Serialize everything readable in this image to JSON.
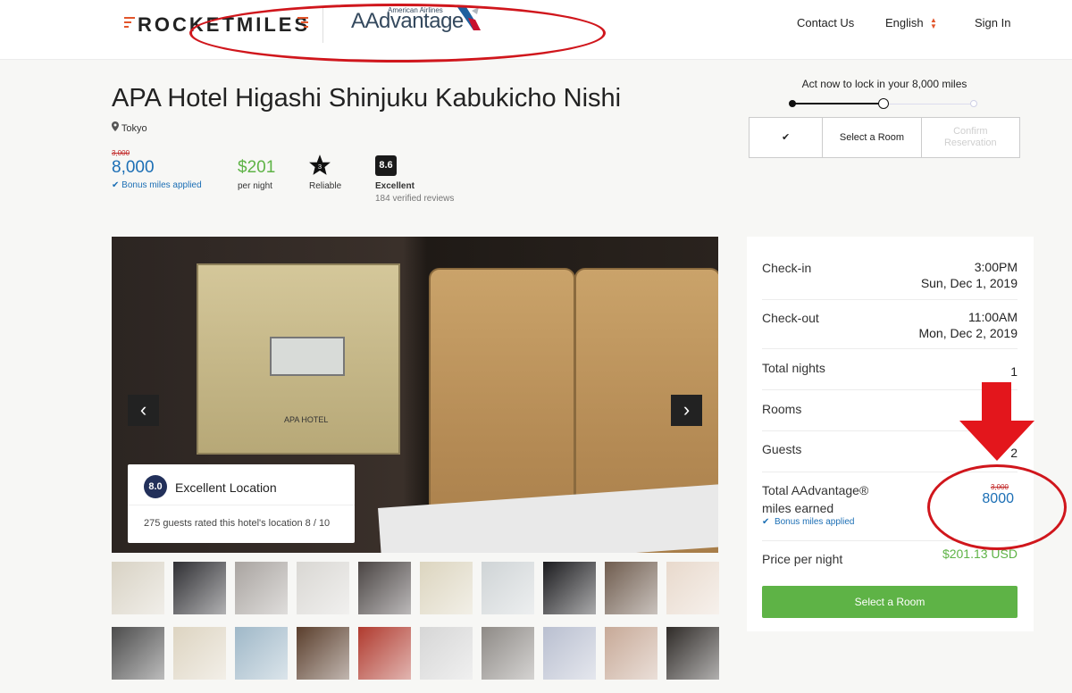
{
  "header": {
    "brand": "ROCKETMILES",
    "partner_top": "American Airlines",
    "partner": "AAdvantage",
    "nav": {
      "contact": "Contact Us",
      "language": "English",
      "sign_in": "Sign In"
    },
    "colors": {
      "brand_orange": "#e2552b",
      "annotation_red": "#d0161c"
    }
  },
  "hotel": {
    "name": "APA Hotel Higashi Shinjuku Kabukicho Nishi",
    "location": "Tokyo",
    "miles_original": "3,000",
    "miles": "8,000",
    "bonus_label": "Bonus miles applied",
    "price": "$201",
    "price_sub": "per night",
    "star_count": "3",
    "reliable_label": "Reliable",
    "score": "8.6",
    "score_label": "Excellent",
    "reviews": "184 verified reviews"
  },
  "progress": {
    "title": "Act now to lock in your 8,000 miles",
    "steps": [
      {
        "label": "✔",
        "state": "done"
      },
      {
        "label": "Select a Room",
        "state": "current"
      },
      {
        "label": "Confirm Reservation",
        "state": "disabled"
      }
    ]
  },
  "gallery": {
    "panel_text": "APA HOTEL",
    "prev_icon": "chevron-left-icon",
    "next_icon": "chevron-right-icon",
    "location_card": {
      "score": "8.0",
      "title": "Excellent Location",
      "subtitle": "275 guests rated this hotel's location 8 / 10"
    },
    "thumbnails_row1": [
      "#d8d2c4",
      "#2f2f33",
      "#a9a4a0",
      "#d9d7d3",
      "#4a4443",
      "#dcd5bf",
      "#cfd4d6",
      "#1c1c1f",
      "#6f5c4e",
      "#e8d9cc"
    ],
    "thumbnails_row2": [
      "#4c4c4c",
      "#ddd4c1",
      "#9fb8c8",
      "#5a3e2c",
      "#b03a2e",
      "#d6d6d6",
      "#8e8a86",
      "#b9bfd0",
      "#c7a997",
      "#2f2b28"
    ]
  },
  "summary": {
    "checkin_label": "Check-in",
    "checkin_time": "3:00PM",
    "checkin_date": "Sun, Dec 1, 2019",
    "checkout_label": "Check-out",
    "checkout_time": "11:00AM",
    "checkout_date": "Mon, Dec 2, 2019",
    "nights_label": "Total nights",
    "nights": "1",
    "rooms_label": "Rooms",
    "guests_label": "Guests",
    "guests": "2",
    "miles_label_1": "Total AAdvantage®",
    "miles_label_2": "miles earned",
    "miles_original": "3,000",
    "miles": "8000",
    "bonus_label": "Bonus miles applied",
    "price_label": "Price per night",
    "price": "$201.13 USD",
    "cta": "Select a Room"
  }
}
